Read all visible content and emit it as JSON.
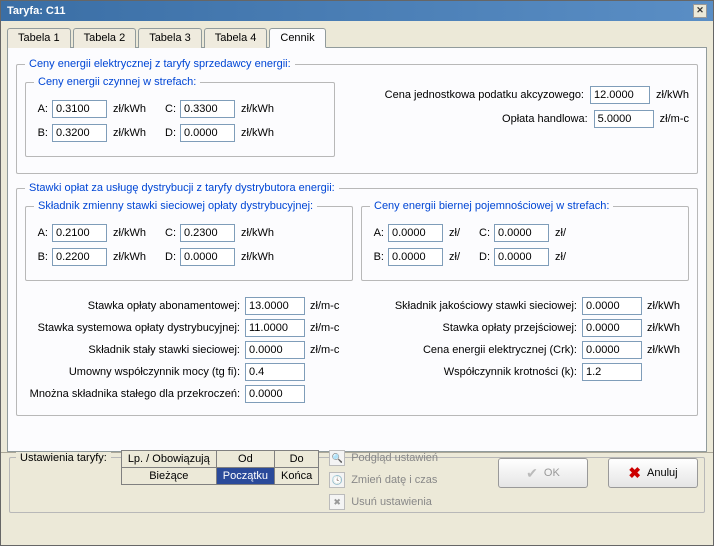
{
  "window": {
    "title": "Taryfa: C11"
  },
  "tabs": [
    "Tabela 1",
    "Tabela 2",
    "Tabela 3",
    "Tabela 4",
    "Cennik"
  ],
  "activeTab": "Cennik",
  "seller": {
    "group": "Ceny energii elektrycznej z taryfy sprzedawcy energii:",
    "zonesGroup": "Ceny energii czynnej w strefach:",
    "A": "0.3100",
    "B": "0.3200",
    "C": "0.3300",
    "D": "0.0000",
    "unit": "zł/kWh",
    "exciseLabel": "Cena jednostkowa podatku akcyzowego:",
    "excise": "12.0000",
    "exciseUnit": "zł/kWh",
    "tradeLabel": "Opłata handlowa:",
    "trade": "5.0000",
    "tradeUnit": "zł/m-c"
  },
  "dist": {
    "group": "Stawki opłat za usługę dystrybucji z taryfy dystrybutora energii:",
    "varGroup": "Składnik zmienny stawki sieciowej opłaty dystrybucyjnej:",
    "varA": "0.2100",
    "varB": "0.2200",
    "varC": "0.2300",
    "varD": "0.0000",
    "varUnit": "zł/kWh",
    "reactiveGroup": "Ceny energii biernej pojemnościowej w strefach:",
    "reA": "0.0000",
    "reB": "0.0000",
    "reC": "0.0000",
    "reD": "0.0000",
    "reUnit": "zł/",
    "abonLabel": "Stawka opłaty abonamentowej:",
    "abon": "13.0000",
    "abonUnit": "zł/m-c",
    "sysLabel": "Stawka systemowa opłaty dystrybucyjnej:",
    "sys": "11.0000",
    "sysUnit": "zł/m-c",
    "fixedLabel": "Składnik stały stawki sieciowej:",
    "fixed": "0.0000",
    "fixedUnit": "zł/m-c",
    "tgfiLabel": "Umowny współczynnik mocy (tg fi):",
    "tgfi": "0.4",
    "multLabel": "Mnożna składnika stałego dla przekroczeń:",
    "mult": "0.0000",
    "qualLabel": "Składnik jakościowy stawki sieciowej:",
    "qual": "0.0000",
    "qualUnit": "zł/kWh",
    "transLabel": "Stawka opłaty przejściowej:",
    "trans": "0.0000",
    "transUnit": "zł/kWh",
    "crkLabel": "Cena energii elektrycznej (Crk):",
    "crk": "0.0000",
    "crkUnit": "zł/kWh",
    "kLabel": "Współczynnik krotności (k):",
    "k": "1.2"
  },
  "settings": {
    "legend": "Ustawienia taryfy:",
    "headers": [
      "Lp. / Obowiązują",
      "Od",
      "Do"
    ],
    "row": [
      "Bieżące",
      "Początku",
      "Końca"
    ],
    "actions": [
      "Podgląd ustawień",
      "Zmień datę i czas",
      "Usuń ustawienia"
    ]
  },
  "buttons": {
    "ok": "OK",
    "cancel": "Anuluj"
  }
}
